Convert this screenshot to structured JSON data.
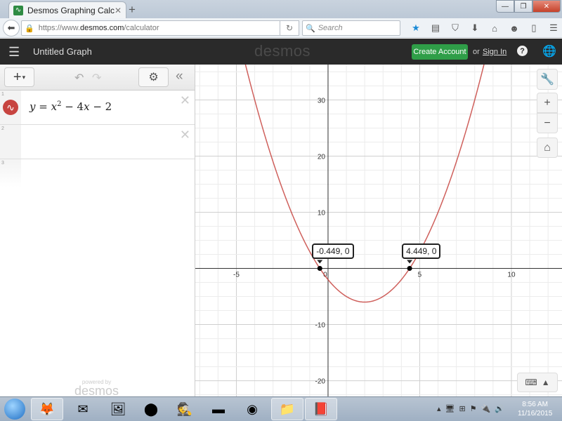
{
  "browser": {
    "tab_title": "Desmos Graphing Calculator",
    "tab_close": "✕",
    "new_tab": "+",
    "url_prefix": "https://www.",
    "url_domain": "desmos.com",
    "url_path": "/calculator",
    "search_placeholder": "Search",
    "window_controls": {
      "minimize": "—",
      "maximize": "❐",
      "close": "✕"
    },
    "toolbar_icons": [
      "star-icon",
      "reading-list-icon",
      "pocket-icon",
      "download-icon",
      "home-icon",
      "chat-icon",
      "extension-k-icon",
      "menu-icon"
    ]
  },
  "header": {
    "graph_title": "Untitled Graph",
    "logo": "desmos",
    "create_account": "Create Account",
    "or": "or",
    "sign_in": "Sign In",
    "help": "?"
  },
  "expressions": {
    "items": [
      {
        "index": "1",
        "color": "#c74440",
        "lhs": "y",
        "eq": " = ",
        "x": "x",
        "pow": "2",
        "rest_1": " − 4",
        "rest_x": "x",
        "rest_2": " − 2",
        "has_delete": true
      },
      {
        "index": "2",
        "has_delete": true
      },
      {
        "index": "3"
      }
    ],
    "powered_by": "powered by",
    "powered_logo": "desmos"
  },
  "graph": {
    "curve_color": "#c74440",
    "points": [
      {
        "label": "-0.449, 0",
        "x": -0.449,
        "y": 0
      },
      {
        "label": "4.449, 0",
        "x": 4.449,
        "y": 0
      }
    ]
  },
  "chart_data": {
    "type": "line",
    "title": "",
    "xlabel": "",
    "ylabel": "",
    "series": [
      {
        "name": "y = x^2 - 4x - 2",
        "function": "x^2-4x-2",
        "color": "#c74440"
      }
    ],
    "xlim": [
      -7.24,
      12.76
    ],
    "ylim": [
      -22.8,
      36.3
    ],
    "x_ticks": [
      "-5",
      "0",
      "5",
      "10"
    ],
    "y_ticks": [
      "30",
      "20",
      "10",
      "-10",
      "-20"
    ],
    "x_tick_values": [
      -5,
      0,
      5,
      10
    ],
    "y_tick_values": [
      30,
      20,
      10,
      -10,
      -20
    ],
    "grid": true,
    "minor_x_step": 1,
    "minor_y_step": 2.5,
    "annotations": [
      "-0.449, 0",
      "4.449, 0"
    ]
  },
  "taskbar": {
    "apps": [
      "firefox-icon",
      "thunderbird-icon",
      "photos-icon",
      "app-blue-icon",
      "spy-icon",
      "cmd-icon",
      "chrome-icon",
      "explorer-icon",
      "pdf-icon"
    ],
    "time": "8:56 AM",
    "date": "11/16/2015"
  }
}
